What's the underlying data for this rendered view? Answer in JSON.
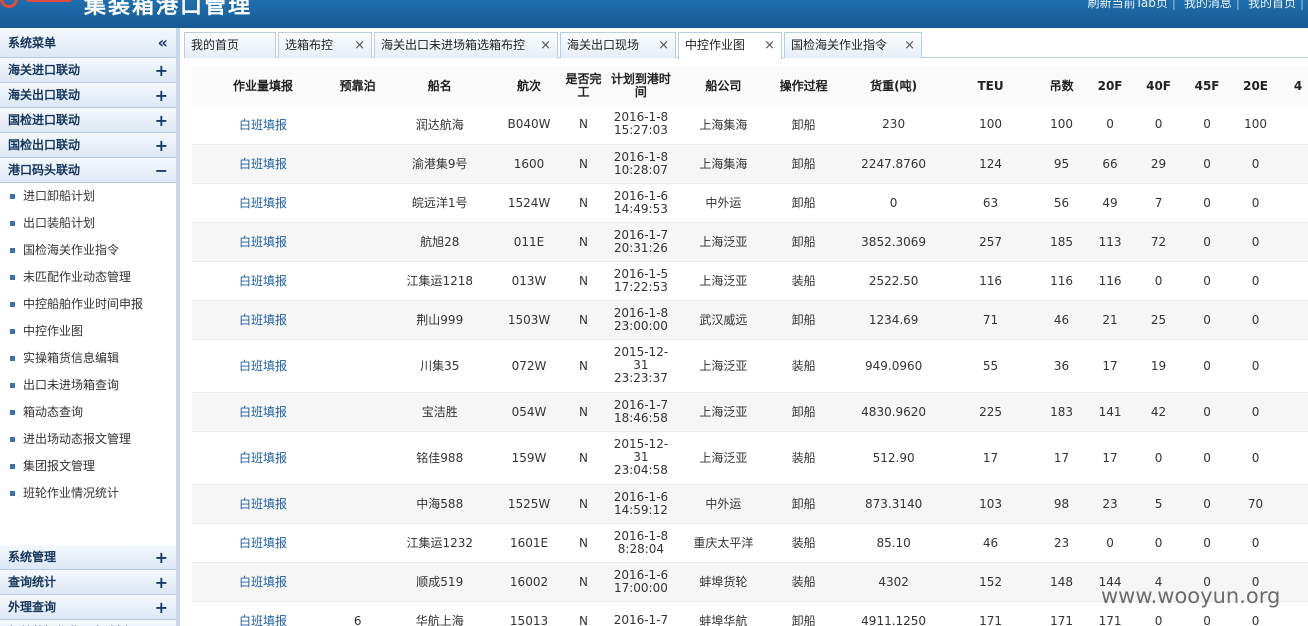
{
  "header": {
    "app_title": "集装箱港口管理",
    "links": [
      "刷新当前Tab页",
      "我的消息",
      "我的首页"
    ],
    "brand_color": "#1f6fae"
  },
  "sidebar": {
    "title": "系统菜单",
    "collapse_icon": "double-chevron-left",
    "groups_top": [
      {
        "label": "海关进口联动",
        "toggle": "+"
      },
      {
        "label": "海关出口联动",
        "toggle": "+"
      },
      {
        "label": "国检进口联动",
        "toggle": "+"
      },
      {
        "label": "国检出口联动",
        "toggle": "+"
      },
      {
        "label": "港口码头联动",
        "toggle": "−"
      }
    ],
    "items": [
      "进口卸船计划",
      "出口装船计划",
      "国检海关作业指令",
      "未匹配作业动态管理",
      "中控船舶作业时间申报",
      "中控作业图",
      "实操箱货信息编辑",
      "出口未进场箱查询",
      "箱动态查询",
      "进出场动态报文管理",
      "集团报文管理",
      "班轮作业情况统计"
    ],
    "groups_bottom": [
      {
        "label": "系统管理",
        "toggle": "+"
      },
      {
        "label": "查询统计",
        "toggle": "+"
      },
      {
        "label": "外理查询",
        "toggle": "+"
      },
      {
        "label": "船舶装卸作业昼夜计划",
        "toggle": "+"
      }
    ]
  },
  "tabs": [
    {
      "label": "我的首页",
      "closable": false,
      "active": false
    },
    {
      "label": "选箱布控",
      "closable": true,
      "active": false
    },
    {
      "label": "海关出口未进场箱选箱布控",
      "closable": true,
      "active": false
    },
    {
      "label": "海关出口现场",
      "closable": true,
      "active": false
    },
    {
      "label": "中控作业图",
      "closable": true,
      "active": true
    },
    {
      "label": "国检海关作业指令",
      "closable": true,
      "active": false
    }
  ],
  "tab_close_glyph": "×",
  "table": {
    "columns": [
      "作业量填报",
      "预靠泊",
      "船名",
      "航次",
      "是否完工",
      "计划到港时间",
      "船公司",
      "操作过程",
      "货重(吨)",
      "TEU",
      "吊数",
      "20F",
      "40F",
      "45F",
      "20E",
      "4"
    ],
    "rows": [
      [
        "白班填报",
        "",
        "润达航海",
        "B040W",
        "N",
        "2016-1-8 15:27:03",
        "上海集海",
        "卸船",
        "230",
        "100",
        "100",
        "0",
        "0",
        "0",
        "100",
        ""
      ],
      [
        "白班填报",
        "",
        "渝港集9号",
        "1600",
        "N",
        "2016-1-8 10:28:07",
        "上海集海",
        "卸船",
        "2247.8760",
        "124",
        "95",
        "66",
        "29",
        "0",
        "0",
        ""
      ],
      [
        "白班填报",
        "",
        "皖远洋1号",
        "1524W",
        "N",
        "2016-1-6 14:49:53",
        "中外运",
        "卸船",
        "0",
        "63",
        "56",
        "49",
        "7",
        "0",
        "0",
        ""
      ],
      [
        "白班填报",
        "",
        "航旭28",
        "011E",
        "N",
        "2016-1-7 20:31:26",
        "上海泛亚",
        "卸船",
        "3852.3069",
        "257",
        "185",
        "113",
        "72",
        "0",
        "0",
        ""
      ],
      [
        "白班填报",
        "",
        "江集运1218",
        "013W",
        "N",
        "2016-1-5 17:22:53",
        "上海泛亚",
        "装船",
        "2522.50",
        "116",
        "116",
        "116",
        "0",
        "0",
        "0",
        ""
      ],
      [
        "白班填报",
        "",
        "荆山999",
        "1503W",
        "N",
        "2016-1-8 23:00:00",
        "武汉威远",
        "卸船",
        "1234.69",
        "71",
        "46",
        "21",
        "25",
        "0",
        "0",
        ""
      ],
      [
        "白班填报",
        "",
        "川集35",
        "072W",
        "N",
        "2015-12-31 23:23:37",
        "上海泛亚",
        "装船",
        "949.0960",
        "55",
        "36",
        "17",
        "19",
        "0",
        "0",
        ""
      ],
      [
        "白班填报",
        "",
        "宝洁胜",
        "054W",
        "N",
        "2016-1-7 18:46:58",
        "上海泛亚",
        "卸船",
        "4830.9620",
        "225",
        "183",
        "141",
        "42",
        "0",
        "0",
        ""
      ],
      [
        "白班填报",
        "",
        "铭佳988",
        "159W",
        "N",
        "2015-12-31 23:04:58",
        "上海泛亚",
        "装船",
        "512.90",
        "17",
        "17",
        "17",
        "0",
        "0",
        "0",
        ""
      ],
      [
        "白班填报",
        "",
        "中海588",
        "1525W",
        "N",
        "2016-1-6 14:59:12",
        "中外运",
        "卸船",
        "873.3140",
        "103",
        "98",
        "23",
        "5",
        "0",
        "70",
        ""
      ],
      [
        "白班填报",
        "",
        "江集运1232",
        "1601E",
        "N",
        "2016-1-8 8:28:04",
        "重庆太平洋",
        "装船",
        "85.10",
        "46",
        "23",
        "0",
        "0",
        "0",
        "0",
        ""
      ],
      [
        "白班填报",
        "",
        "顺成519",
        "16002",
        "N",
        "2016-1-6 17:00:00",
        "蚌埠货轮",
        "装船",
        "4302",
        "152",
        "148",
        "144",
        "4",
        "0",
        "0",
        ""
      ],
      [
        "白班填报",
        "6",
        "华航上海",
        "15013",
        "N",
        "2016-1-7",
        "蚌埠华航",
        "卸船",
        "4911.1250",
        "171",
        "171",
        "171",
        "0",
        "0",
        "0",
        ""
      ]
    ]
  },
  "watermark": "www.wooyun.org"
}
